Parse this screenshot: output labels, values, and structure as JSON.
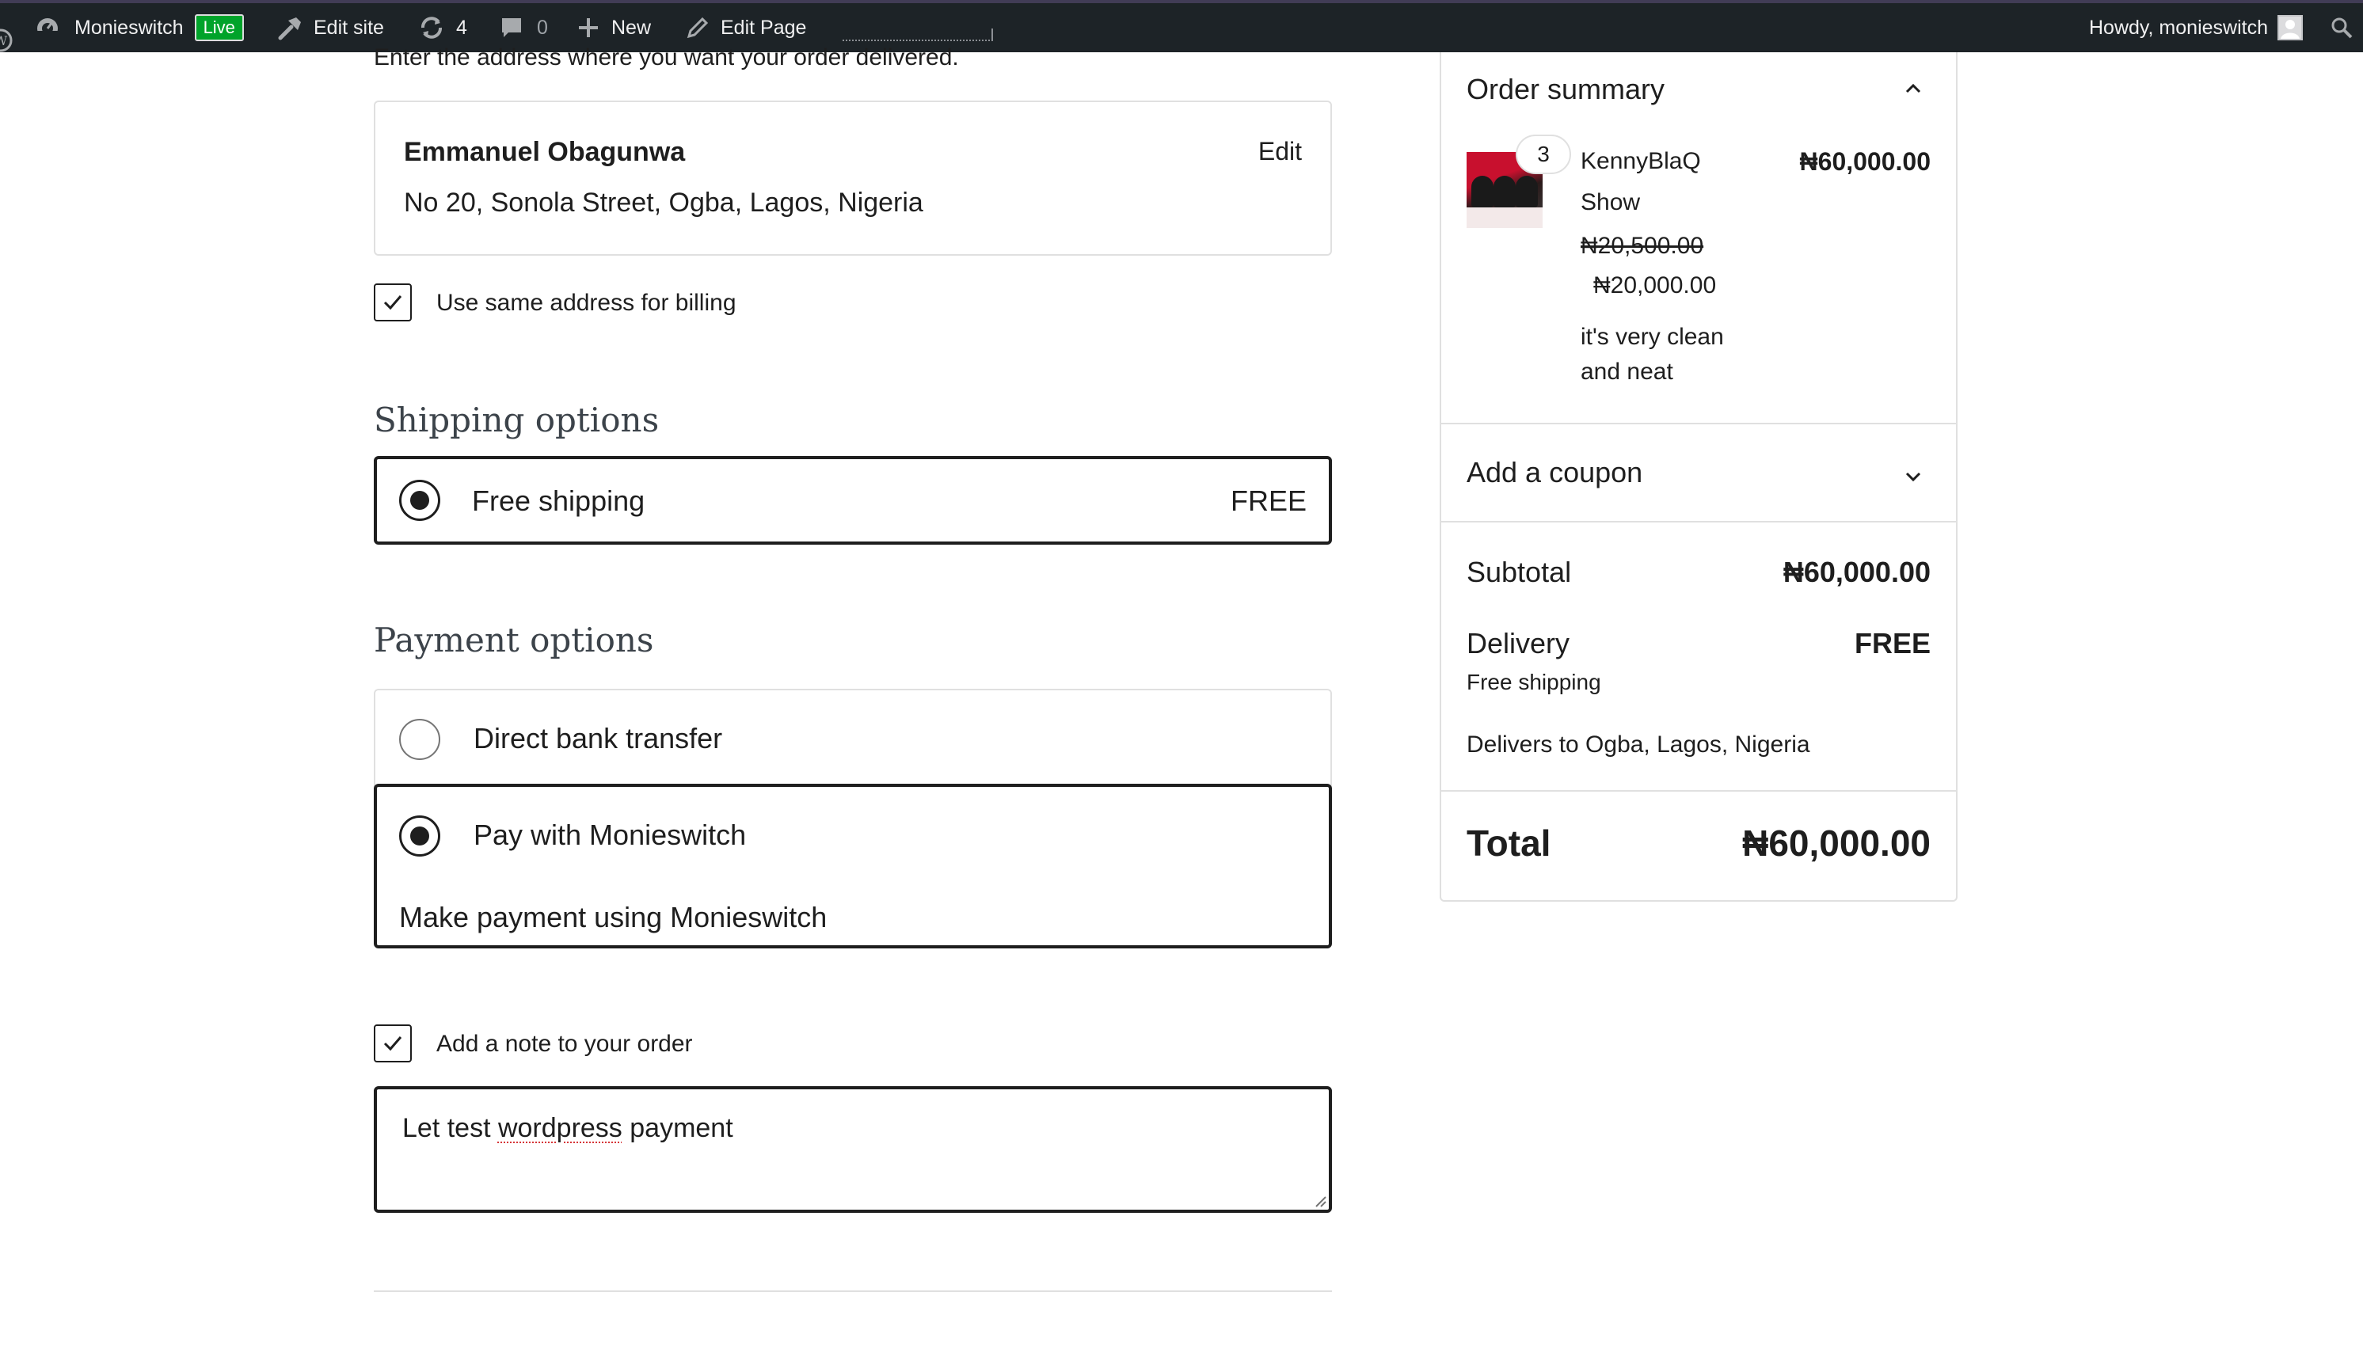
{
  "admin_bar": {
    "site_name": "Monieswitch",
    "live_badge": "Live",
    "edit_site": "Edit site",
    "updates_count": "4",
    "comments_count": "0",
    "new_label": "New",
    "edit_page": "Edit Page",
    "howdy": "Howdy, monieswitch",
    "icons": [
      "wordpress-icon",
      "dashboard-icon",
      "hammer-icon",
      "updates-icon",
      "comment-icon",
      "plus-icon",
      "pencil-icon",
      "avatar-icon",
      "search-icon"
    ]
  },
  "shipping_address": {
    "intro": "Enter the address where you want your order delivered.",
    "name": "Emmanuel Obagunwa",
    "address": "No 20, Sonola Street, Ogba, Lagos, Nigeria",
    "edit_label": "Edit",
    "same_billing_label": "Use same address for billing",
    "same_billing_checked": true
  },
  "shipping_options": {
    "title": "Shipping options",
    "options": [
      {
        "label": "Free shipping",
        "price": "FREE",
        "selected": true
      }
    ]
  },
  "payment_options": {
    "title": "Payment options",
    "options": [
      {
        "label": "Direct bank transfer",
        "selected": false
      },
      {
        "label": "Pay with Monieswitch",
        "selected": true,
        "description": "Make payment using Monieswitch"
      }
    ]
  },
  "order_note": {
    "checkbox_label": "Add a note to your order",
    "checked": true,
    "value_prefix": "Let test ",
    "value_misspelled": "wordpress",
    "value_suffix": " payment"
  },
  "order_summary": {
    "title": "Order summary",
    "items": [
      {
        "quantity": "3",
        "name": "KennyBlaQ Show",
        "total": "₦60,000.00",
        "regular_price": "₦20,500.00",
        "sale_price": "₦20,000.00",
        "description": "it's very clean and neat"
      }
    ],
    "coupon_label": "Add a coupon",
    "subtotal_label": "Subtotal",
    "subtotal_value": "₦60,000.00",
    "delivery_label": "Delivery",
    "delivery_value": "FREE",
    "delivery_method": "Free shipping",
    "delivers_to": "Delivers to Ogba, Lagos, Nigeria",
    "total_label": "Total",
    "total_value": "₦60,000.00"
  },
  "colors": {
    "admin_bar_bg": "#1d2327",
    "live_badge": "#00a32a",
    "border": "#e0e0e0",
    "text": "#1e1e1e"
  }
}
